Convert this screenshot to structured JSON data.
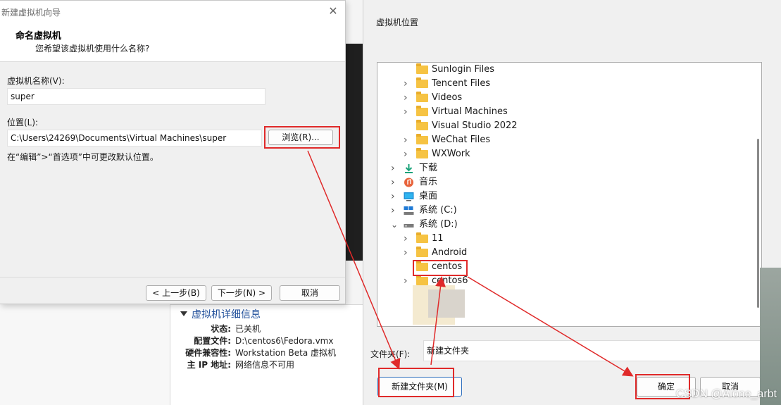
{
  "wizard": {
    "title": "新建虚拟机向导",
    "close_glyph": "✕",
    "heading": "命名虚拟机",
    "subheading": "您希望该虚拟机使用什么名称?",
    "name_label": "虚拟机名称(V):",
    "name_value": "super",
    "location_label": "位置(L):",
    "location_value": "C:\\Users\\24269\\Documents\\Virtual Machines\\super",
    "browse_label": "浏览(R)...",
    "hint": "在“编辑”>“首选项”中可更改默认位置。",
    "back_label": "< 上一步(B)",
    "next_label": "下一步(N) >",
    "cancel_label": "取消"
  },
  "vm_details": {
    "title": "虚拟机详细信息",
    "rows": [
      {
        "key": "状态:",
        "value": "已关机"
      },
      {
        "key": "配置文件:",
        "value": "D:\\centos6\\Fedora.vmx"
      },
      {
        "key": "硬件兼容性:",
        "value": "Workstation Beta 虚拟机"
      },
      {
        "key": "主 IP 地址:",
        "value": "网络信息不可用"
      }
    ]
  },
  "browse": {
    "title": "虚拟机位置",
    "tree": [
      {
        "label": "Sunlogin Files",
        "icon": "folder-icon",
        "expander": "none"
      },
      {
        "label": "Tencent Files",
        "icon": "folder-icon",
        "expander": "right"
      },
      {
        "label": "Videos",
        "icon": "folder-icon",
        "expander": "right"
      },
      {
        "label": "Virtual Machines",
        "icon": "folder-icon",
        "expander": "right"
      },
      {
        "label": "Visual Studio 2022",
        "icon": "folder-icon",
        "expander": "none"
      },
      {
        "label": "WeChat Files",
        "icon": "folder-icon",
        "expander": "right"
      },
      {
        "label": "WXWork",
        "icon": "folder-icon",
        "expander": "right"
      },
      {
        "label": "下载",
        "icon": "download-icon",
        "expander": "right"
      },
      {
        "label": "音乐",
        "icon": "music-icon",
        "expander": "right"
      },
      {
        "label": "桌面",
        "icon": "desktop-icon",
        "expander": "right"
      },
      {
        "label": "系统 (C:)",
        "icon": "drive-c-icon",
        "expander": "right"
      },
      {
        "label": "系统 (D:)",
        "icon": "drive-d-icon",
        "expander": "down"
      },
      {
        "label": "11",
        "icon": "folder-icon",
        "expander": "right"
      },
      {
        "label": "Android",
        "icon": "folder-icon",
        "expander": "right"
      },
      {
        "label": "centos",
        "icon": "folder-icon",
        "expander": "none"
      },
      {
        "label": "centos6",
        "icon": "folder-icon",
        "expander": "right"
      }
    ],
    "folder_label": "文件夹(F):",
    "folder_value": "新建文件夹",
    "new_folder_label": "新建文件夹(M)",
    "ok_label": "确定",
    "cancel_label": "取消"
  },
  "watermark": "CSDN @Alone_arbt",
  "colors": {
    "highlight": "#e02a2a",
    "folder": "#f6c343",
    "details_title": "#1f4e9a"
  }
}
